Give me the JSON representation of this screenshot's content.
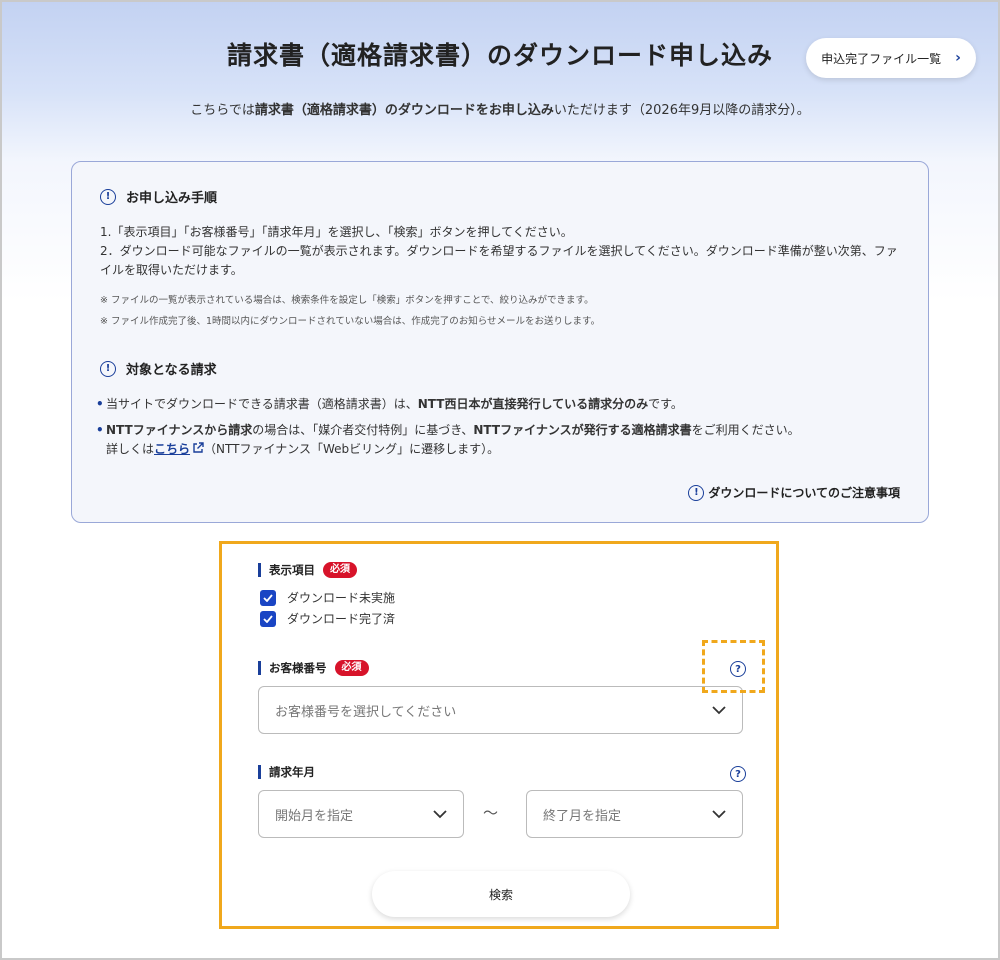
{
  "header": {
    "title": "請求書（適格請求書）のダウンロード申し込み",
    "done_list_button": "申込完了ファイル一覧",
    "subtitle_pre": "こちらでは",
    "subtitle_bold": "請求書（適格請求書）のダウンロードをお申し込み",
    "subtitle_post": "いただけます（2026年9月以降の請求分）。"
  },
  "procedure": {
    "heading": "お申し込み手順",
    "step1": "1.「表示項目」「お客様番号」「請求年月」を選択し、「検索」ボタンを押してください。",
    "step2": "2．ダウンロード可能なファイルの一覧が表示されます。ダウンロードを希望するファイルを選択してください。ダウンロード準備が整い次第、ファイルを取得いただけます。",
    "note1": "※ ファイルの一覧が表示されている場合は、検索条件を設定し「検索」ボタンを押すことで、絞り込みができます。",
    "note2": "※ ファイル作成完了後、1時間以内にダウンロードされていない場合は、作成完了のお知らせメールをお送りします。"
  },
  "target": {
    "heading": "対象となる請求",
    "b1_pre": "当サイトでダウンロードできる請求書（適格請求書）は、",
    "b1_bold": "NTT西日本が直接発行している請求分のみ",
    "b1_post": "です。",
    "b2_bold1": "NTTファイナンスから請求",
    "b2_mid": "の場合は、「媒介者交付特例」に基づき、",
    "b2_bold2": "NTTファイナンスが発行する適格請求書",
    "b2_post": "をご利用ください。",
    "b2_line2_pre": "詳しくは",
    "b2_link": "こちら",
    "b2_line2_post": "（NTTファイナンス「Webビリング」に遷移します）。",
    "caution_link": "ダウンロードについてのご注意事項"
  },
  "form": {
    "display_items_label": "表示項目",
    "required_badge": "必須",
    "check1": "ダウンロード未実施",
    "check2": "ダウンロード完了済",
    "customer_label": "お客様番号",
    "customer_placeholder": "お客様番号を選択してください",
    "billing_label": "請求年月",
    "start_placeholder": "開始月を指定",
    "range_sep": "〜",
    "end_placeholder": "終了月を指定",
    "search_button": "検索",
    "help_glyph": "?"
  },
  "colors": {
    "accent": "#1a3f9a",
    "required": "#d7132a",
    "highlight": "#f0a81c",
    "checkbox": "#1a45c4"
  }
}
